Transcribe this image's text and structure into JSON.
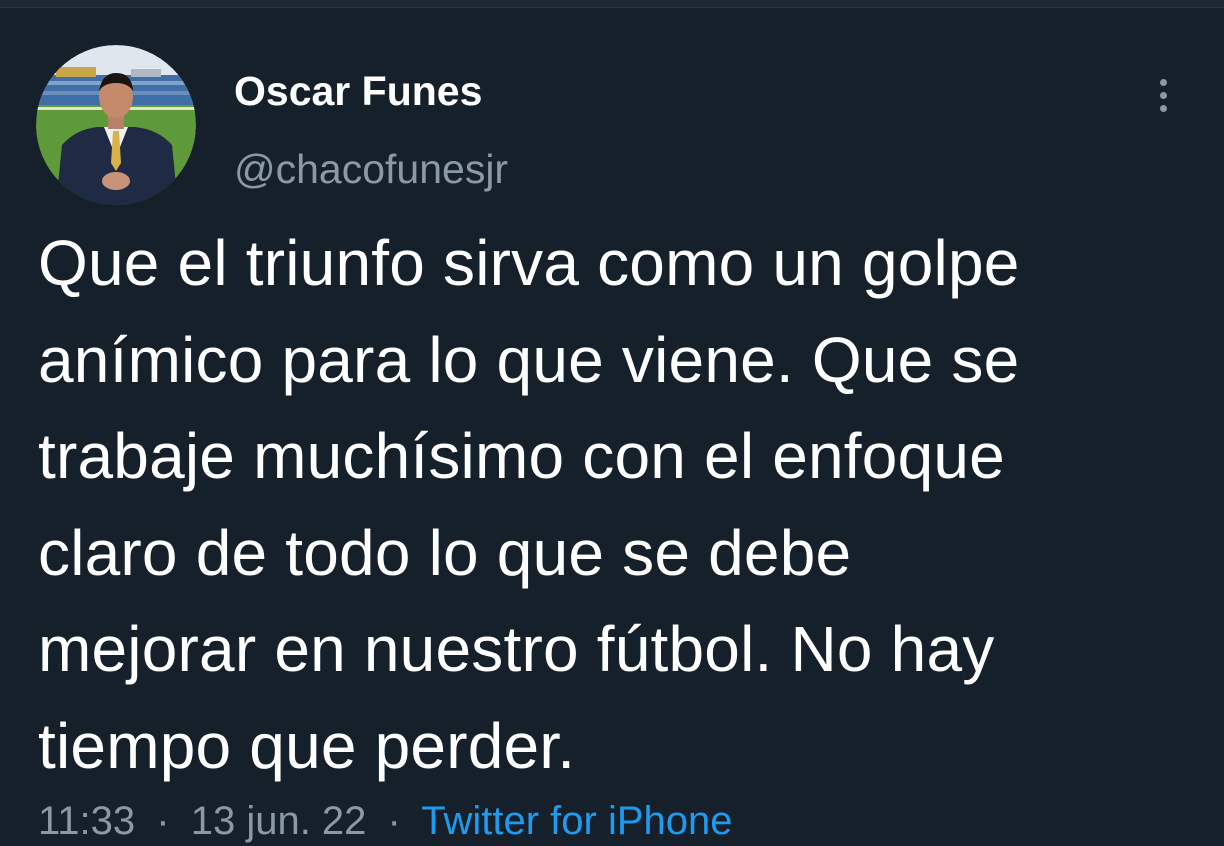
{
  "tweet": {
    "author": {
      "display_name": "Oscar Funes",
      "handle": "@chacofunesjr",
      "avatar_icon": "profile-photo"
    },
    "text": "Que el triunfo sirva como un golpe\nanímico para lo que viene. Que se\ntrabaje muchísimo con el enfoque\nclaro de todo lo que se debe\nmejorar en nuestro fútbol. No hay\ntiempo que perder.",
    "meta": {
      "time": "11:33",
      "separator": "·",
      "date": "13 jun. 22",
      "source": "Twitter for iPhone"
    }
  },
  "icons": {
    "more": "more-vertical-icon"
  },
  "colors": {
    "background": "#15202b",
    "primary_text": "#ffffff",
    "secondary_text": "#8b98a5",
    "link": "#1d9bf0"
  }
}
